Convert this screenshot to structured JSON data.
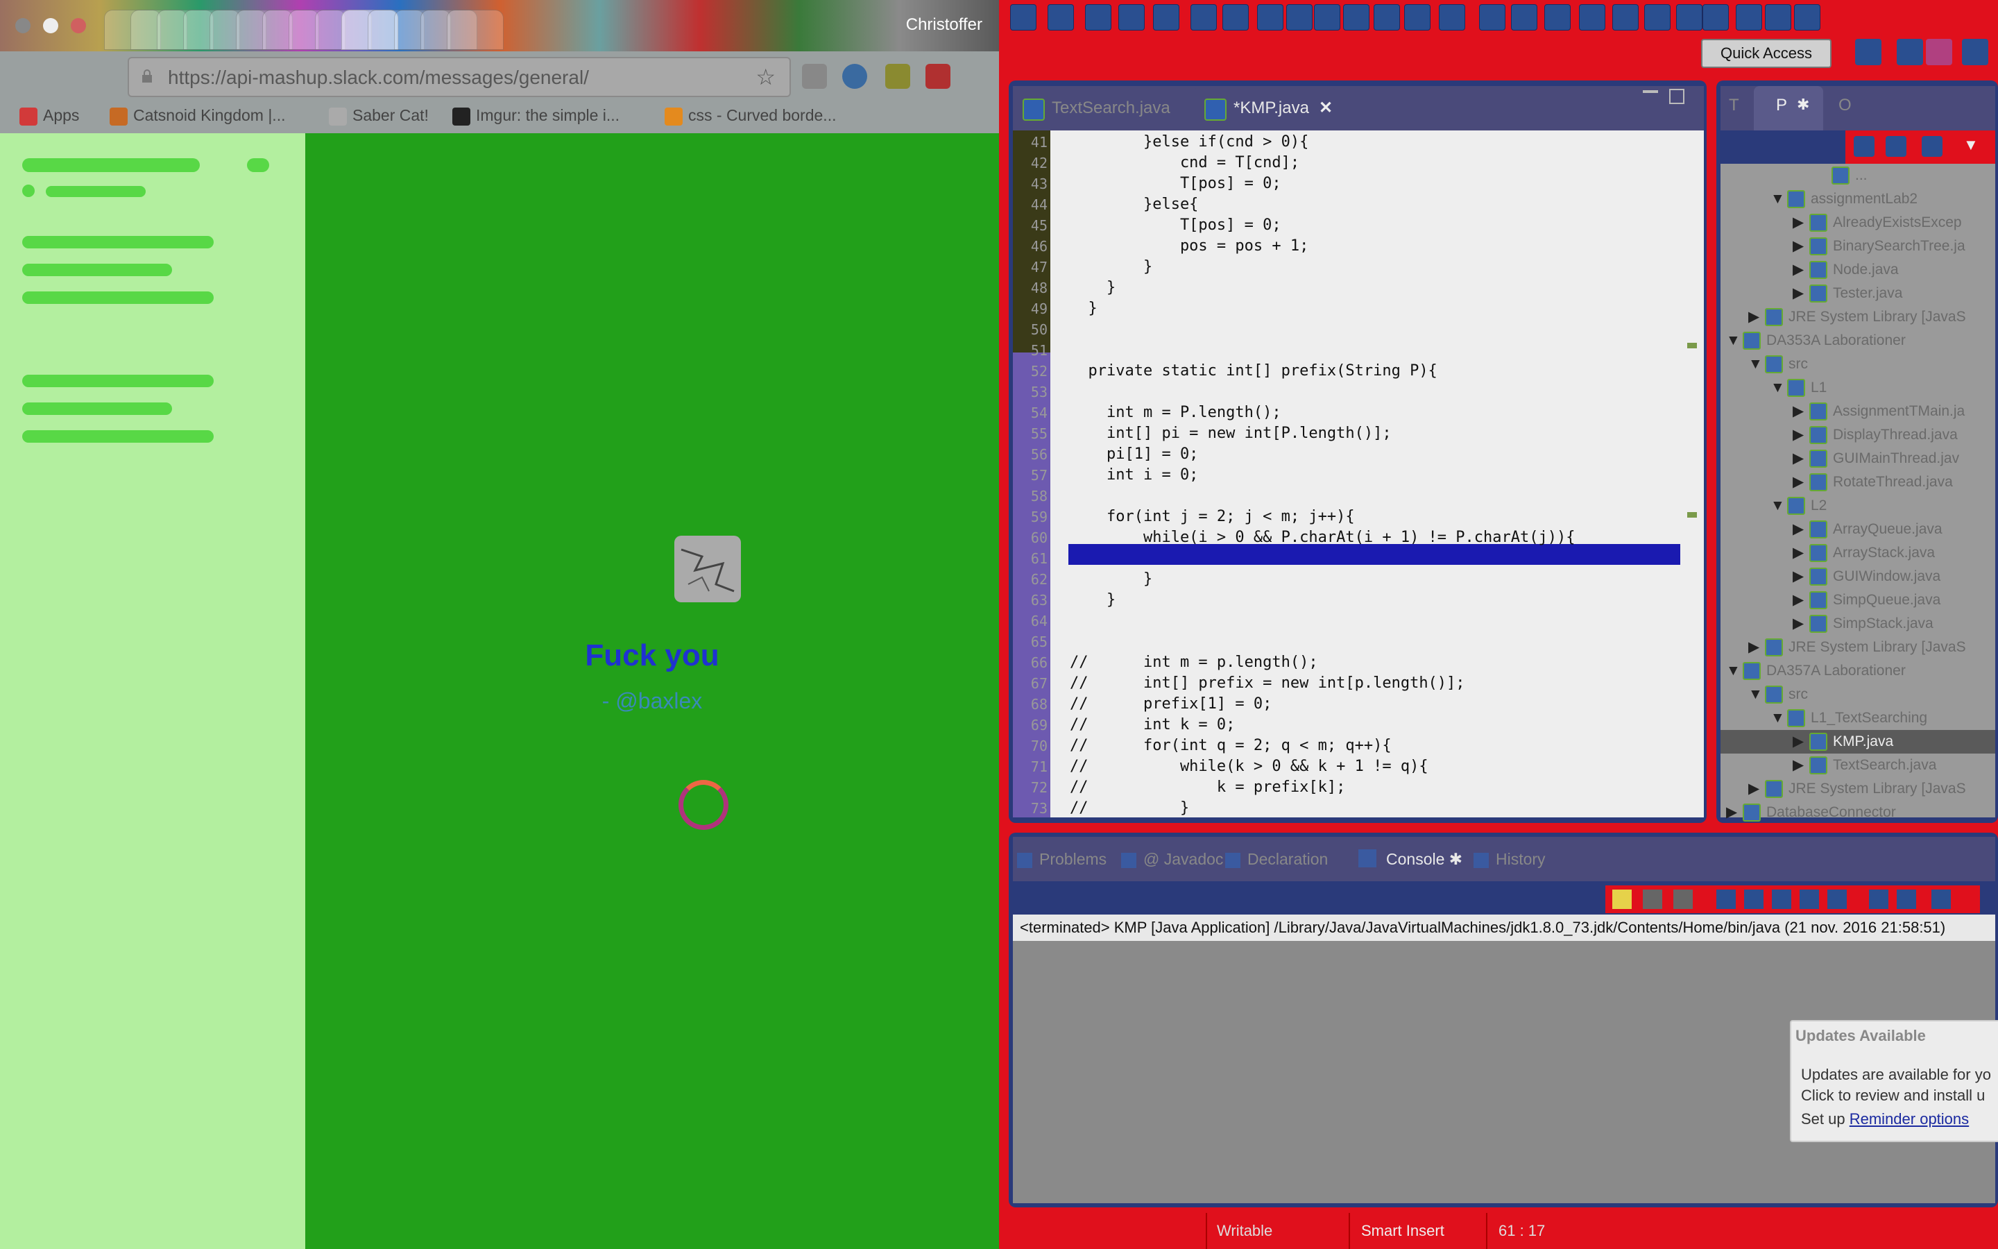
{
  "browser": {
    "tabs": [
      "",
      "",
      "",
      "",
      "",
      "",
      "",
      "",
      "",
      "",
      "",
      "",
      "",
      ""
    ],
    "profile_name": "Christoffer",
    "url": "https://api-mashup.slack.com/messages/general/",
    "bookmarks": [
      {
        "label": "Apps",
        "icon": "apps-grid-icon"
      },
      {
        "label": "Catsnoid Kingdom |...",
        "icon": "page-icon"
      },
      {
        "label": "Saber Cat!",
        "icon": "page-icon"
      },
      {
        "label": "Imgur: the simple i...",
        "icon": "imgur-icon"
      },
      {
        "label": "css - Curved borde...",
        "icon": "stackoverflow-icon"
      }
    ],
    "chat": {
      "title": "Fuck you",
      "subtitle": "- @baxlex"
    }
  },
  "eclipse": {
    "quick_access": "Quick Access",
    "editor_tabs": [
      {
        "label": "TextSearch.java",
        "active": false
      },
      {
        "label": "*KMP.java",
        "active": true
      }
    ],
    "perspective_tabs": [
      "T",
      "P",
      "O"
    ],
    "code_lines": [
      {
        "n": "41",
        "text": "        }else if(cnd > 0){"
      },
      {
        "n": "42",
        "text": "            cnd = T[cnd];"
      },
      {
        "n": "43",
        "text": "            T[pos] = 0;"
      },
      {
        "n": "44",
        "text": "        }else{"
      },
      {
        "n": "45",
        "text": "            T[pos] = 0;"
      },
      {
        "n": "46",
        "text": "            pos = pos + 1;"
      },
      {
        "n": "47",
        "text": "        }"
      },
      {
        "n": "48",
        "text": "    }"
      },
      {
        "n": "49",
        "text": "  }"
      },
      {
        "n": "50",
        "text": ""
      },
      {
        "n": "51",
        "text": ""
      },
      {
        "n": "52",
        "text": "  private static int[] prefix(String P){"
      },
      {
        "n": "53",
        "text": ""
      },
      {
        "n": "54",
        "text": "    int m = P.length();"
      },
      {
        "n": "55",
        "text": "    int[] pi = new int[P.length()];"
      },
      {
        "n": "56",
        "text": "    pi[1] = 0;"
      },
      {
        "n": "57",
        "text": "    int i = 0;"
      },
      {
        "n": "58",
        "text": ""
      },
      {
        "n": "59",
        "text": "    for(int j = 2; j < m; j++){"
      },
      {
        "n": "60",
        "text": "        while(i > 0 && P.charAt(i + 1) != P.charAt(j)){"
      },
      {
        "n": "61",
        "text": ""
      },
      {
        "n": "62",
        "text": "        }"
      },
      {
        "n": "63",
        "text": "    }"
      },
      {
        "n": "64",
        "text": ""
      },
      {
        "n": "65",
        "text": ""
      },
      {
        "n": "66",
        "text": "//      int m = p.length();"
      },
      {
        "n": "67",
        "text": "//      int[] prefix = new int[p.length()];"
      },
      {
        "n": "68",
        "text": "//      prefix[1] = 0;"
      },
      {
        "n": "69",
        "text": "//      int k = 0;"
      },
      {
        "n": "70",
        "text": "//      for(int q = 2; q < m; q++){"
      },
      {
        "n": "71",
        "text": "//          while(k > 0 && k + 1 != q){"
      },
      {
        "n": "72",
        "text": "//              k = prefix[k];"
      },
      {
        "n": "73",
        "text": "//          }"
      }
    ],
    "tree": [
      {
        "indent": 4,
        "arrow": "",
        "label": "...",
        "sel": false
      },
      {
        "indent": 2,
        "arrow": "▼",
        "label": "assignmentLab2",
        "sel": false
      },
      {
        "indent": 3,
        "arrow": "▶",
        "label": "AlreadyExistsExcep",
        "sel": false
      },
      {
        "indent": 3,
        "arrow": "▶",
        "label": "BinarySearchTree.ja",
        "sel": false
      },
      {
        "indent": 3,
        "arrow": "▶",
        "label": "Node.java",
        "sel": false
      },
      {
        "indent": 3,
        "arrow": "▶",
        "label": "Tester.java",
        "sel": false
      },
      {
        "indent": 1,
        "arrow": "▶",
        "label": "JRE System Library [JavaS",
        "sel": false
      },
      {
        "indent": 0,
        "arrow": "▼",
        "label": "DA353A Laborationer",
        "sel": false
      },
      {
        "indent": 1,
        "arrow": "▼",
        "label": "src",
        "sel": false
      },
      {
        "indent": 2,
        "arrow": "▼",
        "label": "L1",
        "sel": false
      },
      {
        "indent": 3,
        "arrow": "▶",
        "label": "AssignmentTMain.ja",
        "sel": false
      },
      {
        "indent": 3,
        "arrow": "▶",
        "label": "DisplayThread.java",
        "sel": false
      },
      {
        "indent": 3,
        "arrow": "▶",
        "label": "GUIMainThread.jav",
        "sel": false
      },
      {
        "indent": 3,
        "arrow": "▶",
        "label": "RotateThread.java",
        "sel": false
      },
      {
        "indent": 2,
        "arrow": "▼",
        "label": "L2",
        "sel": false
      },
      {
        "indent": 3,
        "arrow": "▶",
        "label": "ArrayQueue.java",
        "sel": false
      },
      {
        "indent": 3,
        "arrow": "▶",
        "label": "ArrayStack.java",
        "sel": false
      },
      {
        "indent": 3,
        "arrow": "▶",
        "label": "GUIWindow.java",
        "sel": false
      },
      {
        "indent": 3,
        "arrow": "▶",
        "label": "SimpQueue.java",
        "sel": false
      },
      {
        "indent": 3,
        "arrow": "▶",
        "label": "SimpStack.java",
        "sel": false
      },
      {
        "indent": 1,
        "arrow": "▶",
        "label": "JRE System Library [JavaS",
        "sel": false
      },
      {
        "indent": 0,
        "arrow": "▼",
        "label": "DA357A Laborationer",
        "sel": false
      },
      {
        "indent": 1,
        "arrow": "▼",
        "label": "src",
        "sel": false
      },
      {
        "indent": 2,
        "arrow": "▼",
        "label": "L1_TextSearching",
        "sel": false
      },
      {
        "indent": 3,
        "arrow": "▶",
        "label": "KMP.java",
        "sel": true
      },
      {
        "indent": 3,
        "arrow": "▶",
        "label": "TextSearch.java",
        "sel": false
      },
      {
        "indent": 1,
        "arrow": "▶",
        "label": "JRE System Library [JavaS",
        "sel": false
      },
      {
        "indent": 0,
        "arrow": "▶",
        "label": "DatabaseConnector",
        "sel": false
      }
    ],
    "console_tabs": [
      "Problems",
      "@ Javadoc",
      "Declaration",
      "Console",
      "History"
    ],
    "console_header": "<terminated> KMP [Java Application] /Library/Java/JavaVirtualMachines/jdk1.8.0_73.jdk/Contents/Home/bin/java (21 nov. 2016 21:58:51)",
    "update_popup": {
      "title": "Updates Available",
      "line1": "Updates are available for yo",
      "line2": "Click to review and install u",
      "setup_prefix": "Set up",
      "link": "Reminder options"
    },
    "status": {
      "writable": "Writable",
      "insert_mode": "Smart Insert",
      "position": "61 : 17"
    }
  }
}
